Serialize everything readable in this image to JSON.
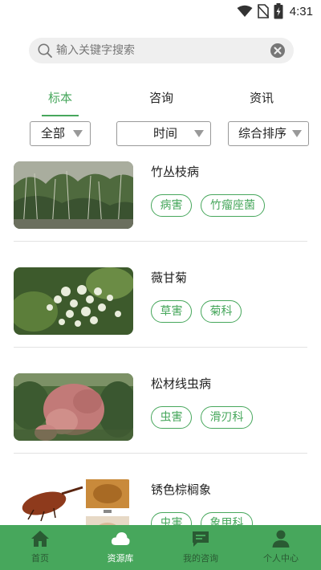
{
  "status_bar": {
    "time": "4:31"
  },
  "search": {
    "placeholder": "输入关键字搜索",
    "value": ""
  },
  "tabs": [
    {
      "label": "标本",
      "active": true
    },
    {
      "label": "咨询",
      "active": false
    },
    {
      "label": "资讯",
      "active": false
    }
  ],
  "filters": [
    {
      "label": "全部"
    },
    {
      "label": "时间"
    },
    {
      "label": "综合排序"
    }
  ],
  "items": [
    {
      "title": "竹丛枝病",
      "tags": [
        "病害",
        "竹瘤座菌"
      ]
    },
    {
      "title": "薇甘菊",
      "tags": [
        "草害",
        "菊科"
      ]
    },
    {
      "title": "松材线虫病",
      "tags": [
        "虫害",
        "滑刃科"
      ]
    },
    {
      "title": "锈色棕榈象",
      "tags": [
        "虫害",
        "象甲科"
      ]
    }
  ],
  "bottom_nav": [
    {
      "label": "首页",
      "icon": "home-icon",
      "active": false
    },
    {
      "label": "资源库",
      "icon": "cloud-icon",
      "active": true
    },
    {
      "label": "我的咨询",
      "icon": "chat-icon",
      "active": false
    },
    {
      "label": "个人中心",
      "icon": "person-icon",
      "active": false
    }
  ],
  "colors": {
    "accent": "#47a75c",
    "nav_bg": "#47a75c",
    "nav_inactive": "#2a5a33"
  }
}
